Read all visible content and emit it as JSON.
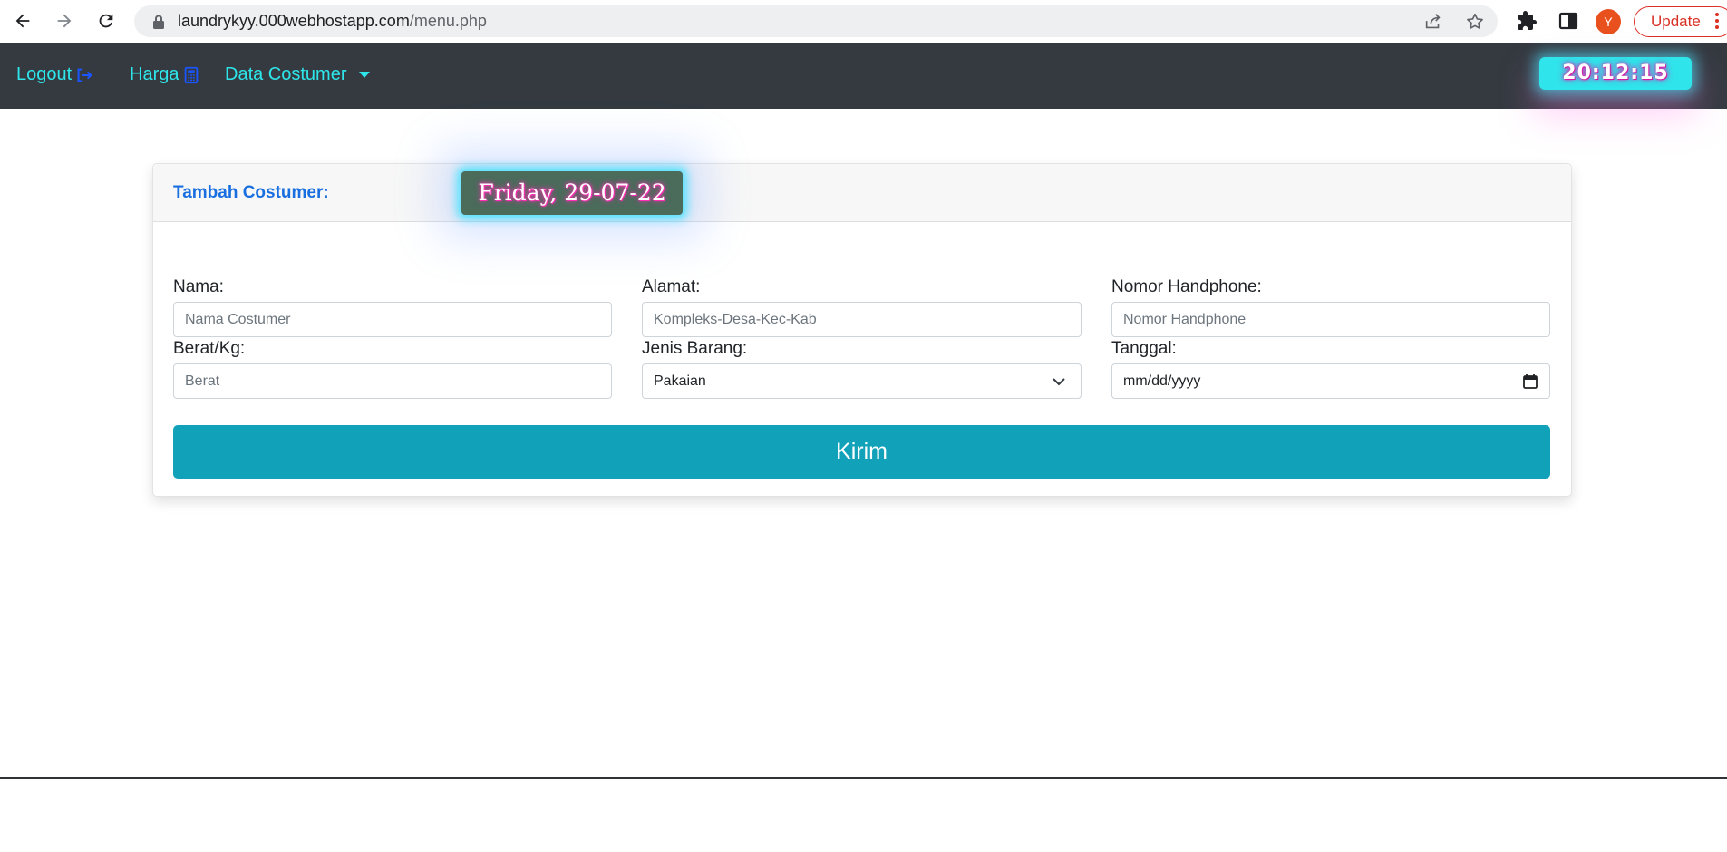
{
  "browser": {
    "url_host": "laundrykyy.000webhostapp.com",
    "url_path": "/menu.php",
    "profile_initial": "Y",
    "update_label": "Update"
  },
  "navbar": {
    "logout_label": "Logout",
    "harga_label": "Harga",
    "data_costumer_label": "Data Costumer",
    "clock_time": "20:12:15"
  },
  "card": {
    "title": "Tambah Costumer:",
    "date_badge": "Friday, 29-07-22"
  },
  "form": {
    "nama": {
      "label": "Nama:",
      "placeholder": "Nama Costumer"
    },
    "alamat": {
      "label": "Alamat:",
      "placeholder": "Kompleks-Desa-Kec-Kab"
    },
    "nomor": {
      "label": "Nomor Handphone:",
      "placeholder": "Nomor Handphone"
    },
    "berat": {
      "label": "Berat/Kg:",
      "placeholder": "Berat"
    },
    "jenis": {
      "label": "Jenis Barang:",
      "selected": "Pakaian"
    },
    "tanggal": {
      "label": "Tanggal:",
      "placeholder": "mm/dd/yyyy"
    },
    "submit_label": "Kirim"
  },
  "icons": {
    "back": "arrow-left-icon",
    "forward": "arrow-right-icon",
    "reload": "reload-icon",
    "lock": "lock-icon",
    "share": "share-icon",
    "bookmark": "star-icon",
    "extensions": "puzzle-icon",
    "sidepanel": "side-panel-icon",
    "logout": "logout-icon",
    "harga": "calculator-icon"
  },
  "colors": {
    "navbar_bg": "#343a40",
    "nav_link": "#2ee6ea",
    "title_blue": "#1a6fe0",
    "submit_bg": "#11a2ba",
    "clock_bg": "#2fe4ea",
    "badge_bg": "#4b6b5b",
    "glow_pink": "#ff30b4",
    "update_red": "#d93025"
  }
}
